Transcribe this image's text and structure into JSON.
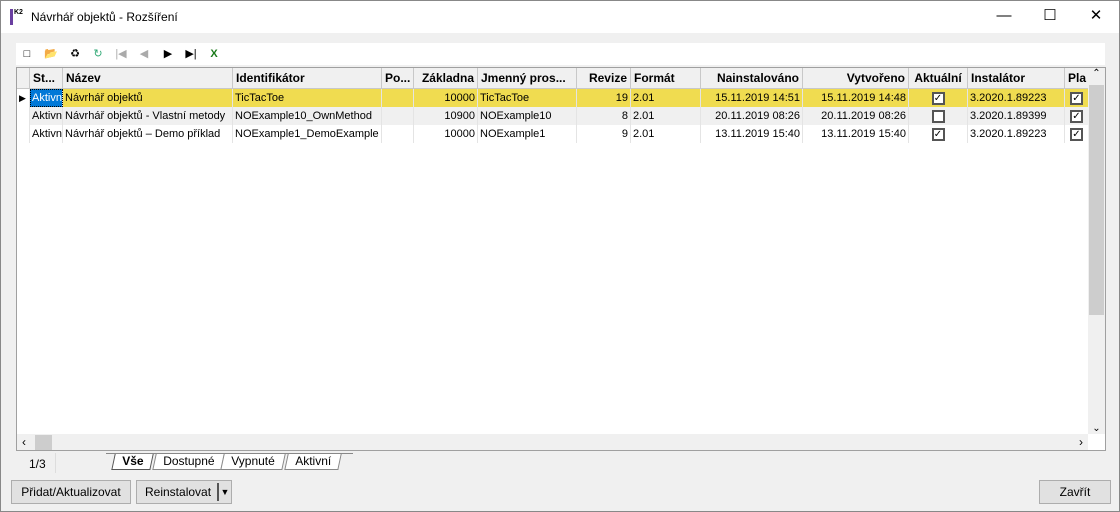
{
  "window": {
    "title": "Návrhář objektů - Rozšíření",
    "icon_text": "K2"
  },
  "toolbar": {
    "icons": [
      "new-icon",
      "open-folder-icon",
      "delete-icon",
      "refresh-icon",
      "first-icon",
      "prev-icon",
      "next-icon",
      "last-icon",
      "excel-export-icon"
    ]
  },
  "grid": {
    "columns": [
      "St...",
      "Název",
      "Identifikátor",
      "Po...",
      "Základna",
      "Jmenný pros...",
      "Revize",
      "Formát",
      "Nainstalováno",
      "Vytvořeno",
      "Aktuální",
      "Instalátor",
      "Pla"
    ],
    "rows": [
      {
        "status": "Aktivn",
        "name": "Návrhář objektů",
        "id": "TicTacToe",
        "po": "",
        "base": "10000",
        "ns": "TicTacToe",
        "rev": "19",
        "format": "2.01",
        "installed": "15.11.2019 14:51",
        "created": "15.11.2019 14:48",
        "current": true,
        "installer": "3.2020.1.89223",
        "pla": true,
        "selected": true
      },
      {
        "status": "Aktivn",
        "name": "Návrhář objektů - Vlastní metody",
        "id": "NOExample10_OwnMethod",
        "po": "",
        "base": "10900",
        "ns": "NOExample10",
        "rev": "8",
        "format": "2.01",
        "installed": "20.11.2019 08:26",
        "created": "20.11.2019 08:26",
        "current": false,
        "installer": "3.2020.1.89399",
        "pla": true
      },
      {
        "status": "Aktivn",
        "name": "Návrhář objektů – Demo příklad",
        "id": "NOExample1_DemoExample",
        "po": "",
        "base": "10000",
        "ns": "NOExample1",
        "rev": "9",
        "format": "2.01",
        "installed": "13.11.2019 15:40",
        "created": "13.11.2019 15:40",
        "current": true,
        "installer": "3.2020.1.89223",
        "pla": true
      }
    ]
  },
  "footer": {
    "record_count": "1/3",
    "tabs": [
      "Vše",
      "Dostupné",
      "Vypnuté",
      "Aktivní"
    ],
    "active_tab": "Vše"
  },
  "buttons": {
    "add_update": "Přidat/Aktualizovat",
    "reinstall": "Reinstalovat",
    "close": "Zavřít"
  },
  "colors": {
    "selected_row": "#f0dc50",
    "selected_cell": "#0078d7"
  }
}
